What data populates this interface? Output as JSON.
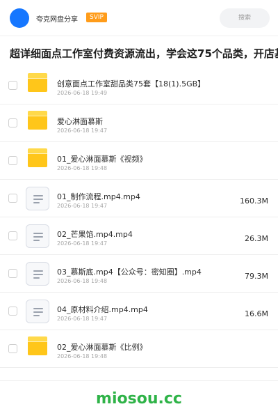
{
  "header": {
    "share_name": "夸克网盘分享",
    "badge": "SVIP",
    "search_label": "搜索"
  },
  "title": "超详细面点工作室付费资源流出，学会这75个品类，开店基",
  "files": [
    {
      "type": "folder",
      "name": "创意面点工作室甜品类75套【18(1).5GB】",
      "date": "2026-06-18 19:49",
      "size": ""
    },
    {
      "type": "folder",
      "name": "爱心淋面慕斯",
      "date": "2026-06-18 19:47",
      "size": ""
    },
    {
      "type": "folder",
      "name": "01_爱心淋面慕斯《视频》",
      "date": "2026-06-18 19:48",
      "size": ""
    },
    {
      "type": "file",
      "name": "01_制作流程.mp4.mp4",
      "date": "2026-06-18 19:47",
      "size": "160.3M"
    },
    {
      "type": "file",
      "name": "02_芒果馅.mp4.mp4",
      "date": "2026-06-18 19:47",
      "size": "26.3M"
    },
    {
      "type": "file",
      "name": "03_慕斯底.mp4【公众号：密知圈】.mp4",
      "date": "2026-06-18 19:48",
      "size": "79.3M"
    },
    {
      "type": "file",
      "name": "04_原材料介绍.mp4.mp4",
      "date": "2026-06-18 19:47",
      "size": "16.6M"
    },
    {
      "type": "folder",
      "name": "02_爱心淋面慕斯《比例》",
      "date": "2026-06-18 19:48",
      "size": ""
    }
  ],
  "watermark": "miosou.cc",
  "colors": {
    "accent": "#1677ff",
    "badge": "#ff9c1a",
    "folder": "#ffc61a",
    "watermark": "#2fb348"
  },
  "icons": {
    "folder": "folder-icon",
    "file": "video-file-icon"
  }
}
